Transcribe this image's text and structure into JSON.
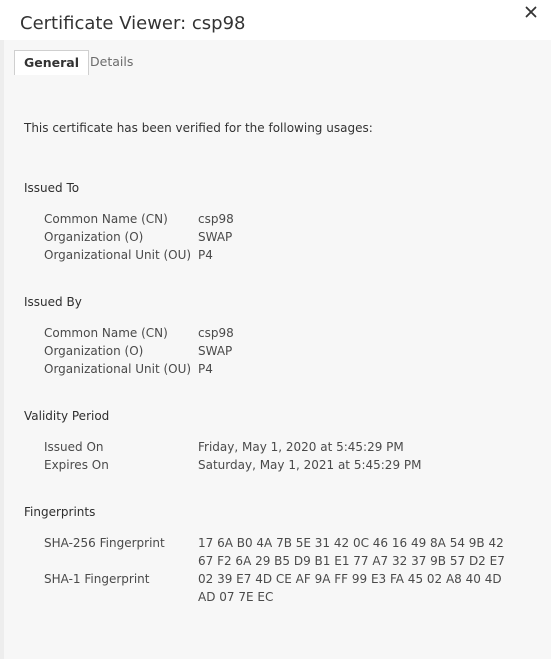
{
  "window": {
    "title": "Certificate Viewer: csp98",
    "close_icon": "close-icon"
  },
  "tabs": [
    {
      "label": "General",
      "active": true
    },
    {
      "label": "Details",
      "active": false
    }
  ],
  "general": {
    "usage_text": "This certificate has been verified for the following usages:",
    "issued_to": {
      "heading": "Issued To",
      "rows": [
        {
          "label": "Common Name (CN)",
          "value": "csp98"
        },
        {
          "label": "Organization (O)",
          "value": "SWAP"
        },
        {
          "label": "Organizational Unit (OU)",
          "value": "P4"
        }
      ]
    },
    "issued_by": {
      "heading": "Issued By",
      "rows": [
        {
          "label": "Common Name (CN)",
          "value": "csp98"
        },
        {
          "label": "Organization (O)",
          "value": "SWAP"
        },
        {
          "label": "Organizational Unit (OU)",
          "value": "P4"
        }
      ]
    },
    "validity": {
      "heading": "Validity Period",
      "rows": [
        {
          "label": "Issued On",
          "value": "Friday, May 1, 2020 at 5:45:29 PM"
        },
        {
          "label": "Expires On",
          "value": "Saturday, May 1, 2021 at 5:45:29 PM"
        }
      ]
    },
    "fingerprints": {
      "heading": "Fingerprints",
      "sha256": {
        "label": "SHA-256 Fingerprint",
        "line1": "17 6A B0 4A 7B 5E 31 42 0C 46 16 49 8A 54 9B 42",
        "line2": "67 F2 6A 29 B5 D9 B1 E1 77 A7 32 37 9B 57 D2 E7"
      },
      "sha1": {
        "label": "SHA-1 Fingerprint",
        "line1": "02 39 E7 4D CE AF 9A FF 99 E3 FA 45 02 A8 40 4D",
        "line2": "AD 07 7E EC"
      }
    }
  }
}
